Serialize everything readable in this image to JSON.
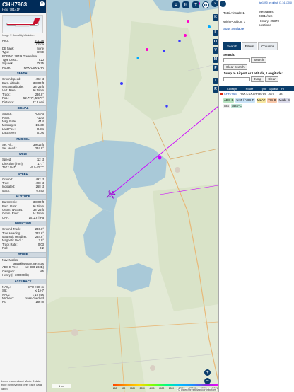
{
  "aircraft": {
    "callsign": "CHH7963",
    "hex_label": "Hex: 78141F",
    "photo_credit": "Image © SupraNightAviation"
  },
  "details": [
    {
      "k": "Reg.:",
      "v": "B-1138",
      "link": true
    },
    {
      "k": "",
      "v": "China",
      "link": false
    },
    {
      "k": "DB flags:",
      "v": "none",
      "link": false
    },
    {
      "k": "Type:",
      "v": "B789",
      "link": false
    },
    {
      "k": "BOEING 787-9 Dreamliner",
      "v": "",
      "link": false
    },
    {
      "k": "Type Desc.:",
      "v": "L2J",
      "link": false
    },
    {
      "k": "Squawk:",
      "v": "7675",
      "link": false
    },
    {
      "k": "Route:",
      "v": "HAK-CSX-LHR",
      "link": false
    }
  ],
  "sections": [
    {
      "title": "SPATIAL",
      "rows": [
        {
          "k": "Groundspeed:",
          "v": "492 kt"
        },
        {
          "k": "Baro. altitude:",
          "v": "38000 ft"
        },
        {
          "k": "WGS84 altitude:",
          "v": "38725 ft"
        },
        {
          "k": "Vert. Rate:",
          "v": "96 ft/min"
        },
        {
          "k": "Track:",
          "v": "236.8°"
        },
        {
          "k": "Pos.:",
          "v": "52.777°, 5.577°"
        },
        {
          "k": "Distance:",
          "v": "27.3 nmi"
        }
      ]
    },
    {
      "title": "SIGNAL",
      "rows": [
        {
          "k": "Source:",
          "v": "ADS-B"
        },
        {
          "k": "RSSI:",
          "v": "-10.0"
        },
        {
          "k": "Msg. Rate:",
          "v": "44.4"
        },
        {
          "k": "Messages:",
          "v": "14439"
        },
        {
          "k": "Last Pos.:",
          "v": "0.3 s"
        },
        {
          "k": "Last Seen:",
          "v": "0.0 s"
        }
      ]
    },
    {
      "title": "FMS SEL",
      "rows": [
        {
          "k": "Sel. Alt.:",
          "v": "38016 ft"
        },
        {
          "k": "Sel. Head.:",
          "v": "234.8°"
        }
      ]
    },
    {
      "title": "WIND",
      "rows": [
        {
          "k": "Speed:",
          "v": "12 kt"
        },
        {
          "k": "Direction (from):",
          "v": "177°"
        },
        {
          "k": "TAT / OAT:",
          "v": "-9 / -42 °C"
        }
      ]
    },
    {
      "title": "SPEED",
      "rows": [
        {
          "k": "Ground:",
          "v": "492 kt"
        },
        {
          "k": "True:",
          "v": "498 kt"
        },
        {
          "k": "Indicated:",
          "v": "268 kt"
        },
        {
          "k": "Mach:",
          "v": "0.840"
        }
      ]
    },
    {
      "title": "ALTITUDE",
      "rows": [
        {
          "k": "Barometric:",
          "v": "38000 ft"
        },
        {
          "k": "Baro. Rate:",
          "v": "96 ft/min"
        },
        {
          "k": "Geom. WGS84:",
          "v": "38725 ft"
        },
        {
          "k": "Geom. Rate:",
          "v": "64 ft/min"
        },
        {
          "k": "QNH:",
          "v": "1012.8 hPa"
        }
      ]
    },
    {
      "title": "DIRECTION",
      "rows": [
        {
          "k": "Ground Track:",
          "v": "236.8°"
        },
        {
          "k": "True Heading:",
          "v": "237.6°"
        },
        {
          "k": "Magnetic Heading:",
          "v": "234.8°"
        },
        {
          "k": "Magnetic Decl.:",
          "v": "2.9°"
        },
        {
          "k": "Track Rate:",
          "v": "0.03"
        },
        {
          "k": "Roll:",
          "v": "0.2"
        }
      ]
    },
    {
      "title": "STUFF",
      "rows": [
        {
          "k": "Nav. Modes:",
          "v": ""
        },
        {
          "k": "",
          "v": "autopilot,vnav,lnav,tcas"
        },
        {
          "k": "ADS-B Ver.:",
          "v": "v2 (DO-260B)"
        },
        {
          "k": "Category:",
          "v": "A5"
        },
        {
          "k": "Heavy (> 300000 lb)",
          "v": ""
        }
      ]
    },
    {
      "title": "ACCURACY",
      "rows": [
        {
          "k": "NACₚ:",
          "v": "EPU < 30 m"
        },
        {
          "k": "SIL:",
          "v": "≤ 1e-7"
        },
        {
          "k": "NACᵥ:",
          "v": "< 10 m/s"
        },
        {
          "k": "NICbaro:",
          "v": "cross-checked"
        },
        {
          "k": "Rc:",
          "v": "186 m"
        }
      ]
    }
  ],
  "footer_note": "Learn more about Mode S data type by hovering over each data label.",
  "map": {
    "top_buttons": [
      "U",
      "H",
      "T"
    ],
    "side_buttons": [
      "K",
      "L",
      "O",
      "V",
      "M",
      "P",
      "I",
      "R"
    ],
    "scale_label": "1 km",
    "attribution": "© OpenStreetMap contributors",
    "altitude_ticks": [
      "200",
      "500",
      "1000",
      "2000",
      "4000",
      "6000",
      "8000",
      "10000",
      "20000",
      "30000",
      "40000+"
    ],
    "colors": {
      "water": "#a9c9d8",
      "land": "#e3ead6",
      "route": "#cc00ff",
      "aircraft": "#9900cc"
    }
  },
  "right_panel": {
    "version_link": "tar1090 on github (3.14.1704)",
    "total_aircraft": "Total Aircraft: 1",
    "with_position": "With Position: 1",
    "stats_label": "Stats available",
    "messages": "Messages:",
    "messages_rate": "2381 /sec",
    "history": "History: 25370",
    "history2": "positions",
    "tabs": [
      "Search",
      "Filters",
      "Columns"
    ],
    "search_label": "Search:",
    "search_button": "Search",
    "clear_search": "Clear Search",
    "jump_label": "Jump to Airport or Latitude, Longitude:",
    "jump_button": "Jump",
    "clear_button": "Clear",
    "table_headers": [
      "",
      "Callsign",
      "Route",
      "Type",
      "Squawk",
      "Hi"
    ],
    "table_row": [
      "",
      "CHH7963",
      "HAK-CSX-LHR",
      "B789",
      "7675",
      "38"
    ],
    "badges": [
      {
        "label": "ADS-B",
        "color": "#b7e3c1"
      },
      {
        "label": "UAT / ADS-R",
        "color": "#c9e3f7"
      },
      {
        "label": "MLAT",
        "color": "#f7e7a0"
      },
      {
        "label": "TIS-B",
        "color": "#f7c6a8"
      },
      {
        "label": "Mode-S",
        "color": "#d8d8e8"
      },
      {
        "label": "AIS",
        "color": "#eeeeee"
      },
      {
        "label": "ADS-C",
        "color": "#c1e6d8"
      }
    ]
  }
}
